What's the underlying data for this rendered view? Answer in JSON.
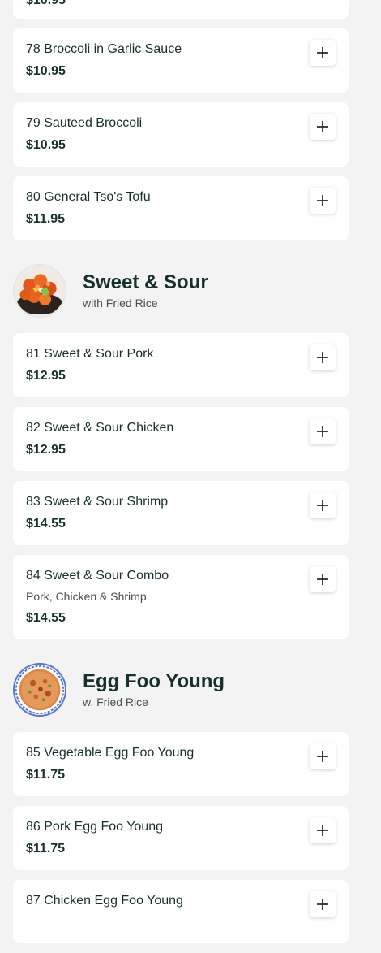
{
  "partial_item": {
    "price": "$10.95"
  },
  "groups": [
    {
      "items": [
        {
          "name": "78 Broccoli in Garlic Sauce",
          "price": "$10.95"
        },
        {
          "name": "79 Sauteed Broccoli",
          "price": "$10.95"
        },
        {
          "name": "80 General Tso's Tofu",
          "price": "$11.95"
        }
      ]
    }
  ],
  "sections": [
    {
      "title": "Sweet & Sour",
      "subtitle": "with Fried Rice",
      "items": [
        {
          "name": "81 Sweet & Sour Pork",
          "price": "$12.95"
        },
        {
          "name": "82 Sweet & Sour Chicken",
          "price": "$12.95"
        },
        {
          "name": "83 Sweet & Sour Shrimp",
          "price": "$14.55"
        },
        {
          "name": "84 Sweet & Sour Combo",
          "description": "Pork, Chicken & Shrimp",
          "price": "$14.55"
        }
      ]
    },
    {
      "title": "Egg Foo Young",
      "subtitle": "w. Fried Rice",
      "items": [
        {
          "name": "85 Vegetable Egg Foo Young",
          "price": "$11.75"
        },
        {
          "name": "86 Pork Egg Foo Young",
          "price": "$11.75"
        },
        {
          "name": "87 Chicken Egg Foo Young",
          "price": ""
        }
      ]
    }
  ],
  "icons": {
    "add": "plus-icon"
  },
  "colors": {
    "background": "#f3f3f4",
    "card": "#ffffff",
    "text": "#17302d"
  }
}
